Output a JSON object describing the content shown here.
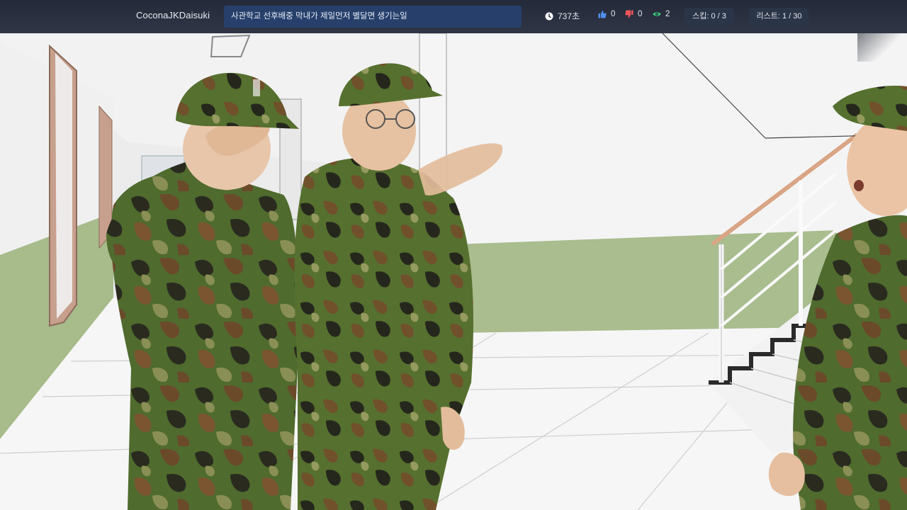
{
  "header": {
    "channel_name": "CoconaJKDaisuki",
    "video_title": "사관학교 선후배중 막내가 제일먼저 별달면 생기는일",
    "time_label": "737초",
    "likes": "0",
    "dislikes": "0",
    "views": "2",
    "skip_label": "스킵: 0 / 3",
    "list_label": "리스트: 1 / 30"
  },
  "icons": {
    "time": "clock-icon",
    "likes": "thumbs-up-icon",
    "dislikes": "thumbs-down-icon",
    "views": "eye-icon"
  },
  "colors": {
    "topbar": "#1f2536",
    "title_box": "#27406b",
    "like_icon": "#4f8ff0",
    "dislike_icon": "#f0555a",
    "view_icon": "#3fd07a",
    "pill": "#2b3548"
  },
  "scene": {
    "description_tag": "video-frame"
  }
}
